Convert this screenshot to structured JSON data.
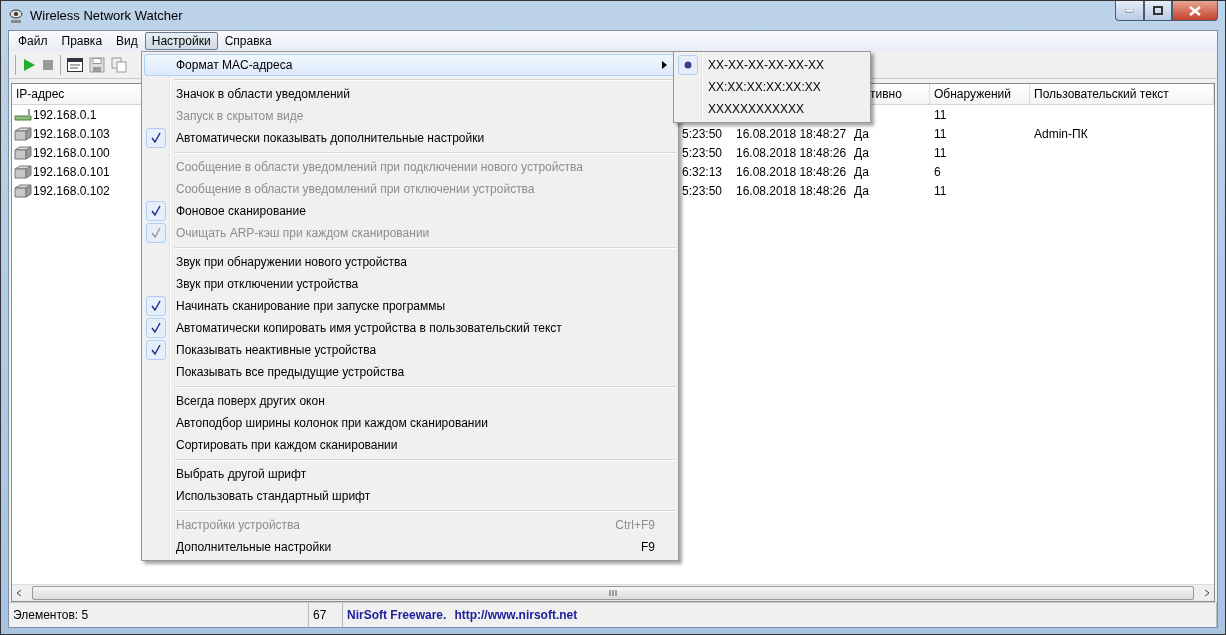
{
  "window": {
    "title": "Wireless Network Watcher"
  },
  "menu_bar": [
    {
      "label": "Файл",
      "selected": false
    },
    {
      "label": "Правка",
      "selected": false
    },
    {
      "label": "Вид",
      "selected": false
    },
    {
      "label": "Настройки",
      "selected": true
    },
    {
      "label": "Справка",
      "selected": false
    }
  ],
  "toolbar": [
    {
      "kind": "play",
      "disabled": false
    },
    {
      "kind": "stop",
      "disabled": true
    },
    {
      "kind": "sep"
    },
    {
      "kind": "properties",
      "disabled": false
    },
    {
      "kind": "save",
      "disabled": true
    },
    {
      "kind": "copy",
      "disabled": true
    }
  ],
  "table": {
    "columns": [
      {
        "kind": "ip",
        "label": "IP-адрес"
      },
      {
        "kind": "time"
      },
      {
        "kind": "date"
      },
      {
        "kind": "active",
        "label": "тивно"
      },
      {
        "kind": "count",
        "label": "Обнаружений"
      },
      {
        "kind": "user",
        "label": "Пользовательский текст"
      }
    ],
    "rows": [
      {
        "kind": "router",
        "ip": "192.168.0.1",
        "count": "11"
      },
      {
        "kind": "computer",
        "ip": "192.168.0.103",
        "time": "5:23:50",
        "date": "16.08.2018 18:48:27",
        "active": "Да",
        "count": "11",
        "user": "Admin-ПК"
      },
      {
        "kind": "computer",
        "ip": "192.168.0.100",
        "time": "5:23:50",
        "date": "16.08.2018 18:48:26",
        "active": "Да",
        "count": "11"
      },
      {
        "kind": "computer",
        "ip": "192.168.0.101",
        "time": "6:32:13",
        "date": "16.08.2018 18:48:26",
        "active": "Да",
        "count": "6"
      },
      {
        "kind": "computer",
        "ip": "192.168.0.102",
        "time": "5:23:50",
        "date": "16.08.2018 18:48:26",
        "active": "Да",
        "count": "11"
      }
    ]
  },
  "menu": {
    "items": [
      {
        "kind": "item",
        "label": "Формат MAC-адреса",
        "submenu": true,
        "selected": true,
        "checked": false,
        "disabled": false
      },
      {
        "kind": "separator"
      },
      {
        "kind": "item",
        "label": "Значок в области уведомлений",
        "checked": false,
        "disabled": false,
        "selected": false
      },
      {
        "kind": "item",
        "label": "Запуск в скрытом виде",
        "checked": false,
        "disabled": true,
        "selected": false
      },
      {
        "kind": "item",
        "label": "Автоматически показывать дополнительные настройки",
        "checked": true,
        "disabled": false,
        "selected": false
      },
      {
        "kind": "separator"
      },
      {
        "kind": "item",
        "label": "Сообщение в области уведомлений при подключении нового устройства",
        "checked": false,
        "disabled": true,
        "selected": false
      },
      {
        "kind": "item",
        "label": "Сообщение в области уведомлений при отключении устройства",
        "checked": false,
        "disabled": true,
        "selected": false
      },
      {
        "kind": "item",
        "label": "Фоновое сканирование",
        "checked": true,
        "disabled": false,
        "selected": false
      },
      {
        "kind": "item",
        "label": "Очищать ARP-кэш при каждом сканировании",
        "checked": true,
        "disabled": true,
        "selected": false
      },
      {
        "kind": "separator"
      },
      {
        "kind": "item",
        "label": "Звук при обнаружении нового устройства",
        "checked": false,
        "disabled": false,
        "selected": false
      },
      {
        "kind": "item",
        "label": "Звук при отключении устройства",
        "checked": false,
        "disabled": false,
        "selected": false
      },
      {
        "kind": "item",
        "label": "Начинать сканирование при запуске программы",
        "checked": true,
        "disabled": false,
        "selected": false
      },
      {
        "kind": "item",
        "label": "Автоматически копировать имя устройства в пользовательский текст",
        "checked": true,
        "disabled": false,
        "selected": false
      },
      {
        "kind": "item",
        "label": "Показывать неактивные устройства",
        "checked": true,
        "disabled": false,
        "selected": false
      },
      {
        "kind": "item",
        "label": "Показывать все предыдущие устройства",
        "checked": false,
        "disabled": false,
        "selected": false
      },
      {
        "kind": "separator"
      },
      {
        "kind": "item",
        "label": "Всегда поверх других окон",
        "checked": false,
        "disabled": false,
        "selected": false
      },
      {
        "kind": "item",
        "label": "Автоподбор ширины колонок при каждом сканировании",
        "checked": false,
        "disabled": false,
        "selected": false
      },
      {
        "kind": "item",
        "label": "Сортировать при каждом сканировании",
        "checked": false,
        "disabled": false,
        "selected": false
      },
      {
        "kind": "separator"
      },
      {
        "kind": "item",
        "label": "Выбрать другой шрифт",
        "checked": false,
        "disabled": false,
        "selected": false
      },
      {
        "kind": "item",
        "label": "Использовать стандартный шрифт",
        "checked": false,
        "disabled": false,
        "selected": false
      },
      {
        "kind": "separator"
      },
      {
        "kind": "item",
        "label": "Настройки устройства",
        "shortcut": "Ctrl+F9",
        "checked": false,
        "disabled": true,
        "selected": false
      },
      {
        "kind": "item",
        "label": "Дополнительные настройки",
        "shortcut": "F9",
        "checked": false,
        "disabled": false,
        "selected": false
      }
    ]
  },
  "submenu": {
    "items": [
      {
        "label": "XX-XX-XX-XX-XX-XX",
        "selected": true
      },
      {
        "label": "XX:XX:XX:XX:XX:XX",
        "selected": false
      },
      {
        "label": "XXXXXXXXXXXX",
        "selected": false
      }
    ]
  },
  "status_bar": {
    "items": "Элементов: 5",
    "count": "67",
    "vendor": "NirSoft Freeware.",
    "link": "http://www.nirsoft.net"
  }
}
